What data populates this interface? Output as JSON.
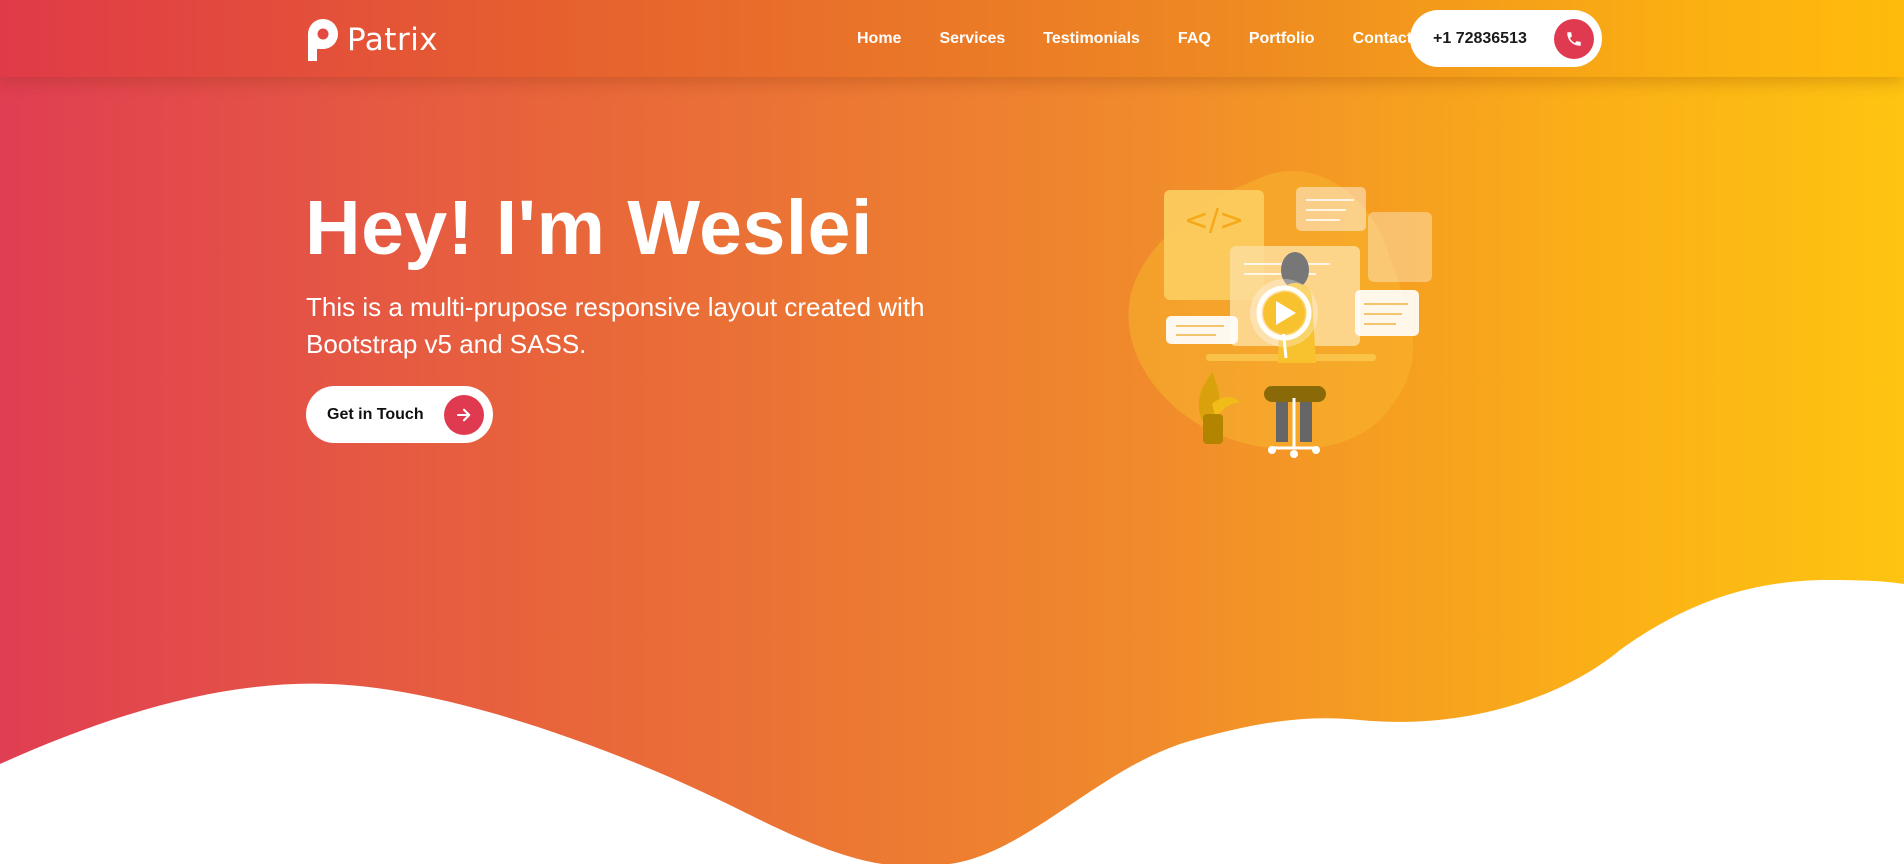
{
  "brand": {
    "name": "Patrix",
    "logo_icon": "p-logo-icon"
  },
  "nav": {
    "items": [
      {
        "label": "Home"
      },
      {
        "label": "Services"
      },
      {
        "label": "Testimonials"
      },
      {
        "label": "FAQ"
      },
      {
        "label": "Portfolio"
      },
      {
        "label": "Contact"
      }
    ],
    "phone": {
      "number": "+1 72836513",
      "icon": "phone-icon"
    }
  },
  "hero": {
    "title": "Hey! I'm Weslei",
    "subtitle": "This is a multi-prupose responsive layout created with Bootstrap v5 and SASS.",
    "cta": {
      "label": "Get in Touch",
      "icon": "arrow-right-icon"
    },
    "illustration_icons": [
      "code-icon",
      "play-icon"
    ]
  },
  "colors": {
    "gradient_start": "#e03e52",
    "gradient_mid": "#f08a2c",
    "gradient_end": "#fec411",
    "accent": "#df3a50",
    "white": "#ffffff"
  }
}
